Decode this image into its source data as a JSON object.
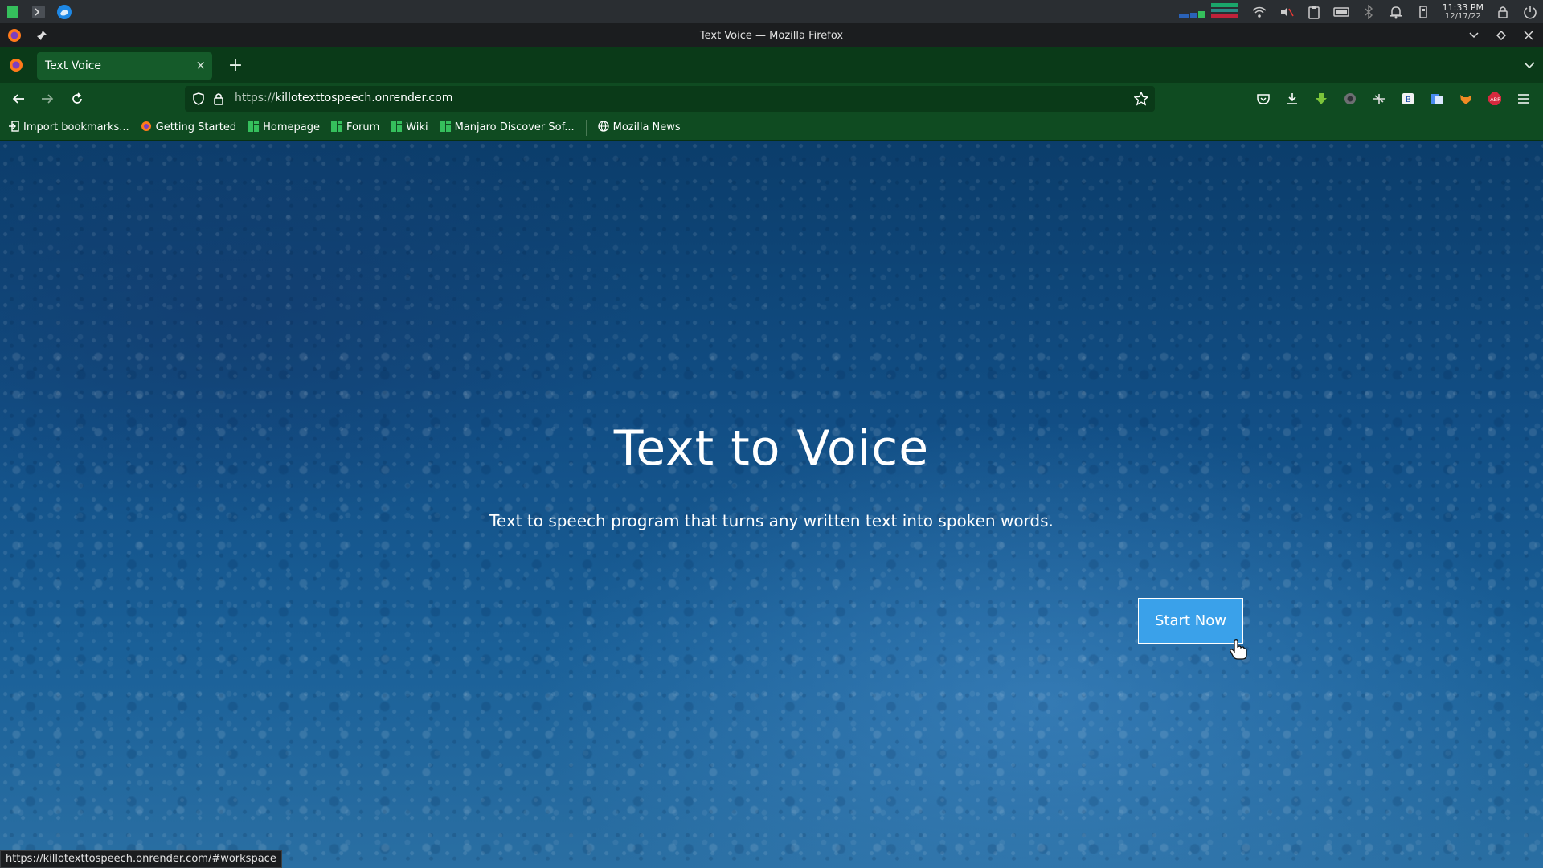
{
  "panel": {
    "time": "11:33 PM",
    "date": "12/17/22"
  },
  "window": {
    "title": "Text Voice — Mozilla Firefox"
  },
  "tab": {
    "label": "Text Voice",
    "close_glyph": "×",
    "new_tab_glyph": "+"
  },
  "address": {
    "protocol": "https://",
    "host": "killotexttospeech.onrender.com"
  },
  "bookmarks": [
    {
      "label": "Import bookmarks...",
      "icon": "import-icon"
    },
    {
      "label": "Getting Started",
      "icon": "firefox-icon"
    },
    {
      "label": "Homepage",
      "icon": "manjaro-icon"
    },
    {
      "label": "Forum",
      "icon": "manjaro-icon"
    },
    {
      "label": "Wiki",
      "icon": "manjaro-icon"
    },
    {
      "label": "Manjaro Discover Sof...",
      "icon": "manjaro-icon"
    },
    {
      "label": "Mozilla News",
      "icon": "globe-icon"
    }
  ],
  "hero": {
    "title": "Text to Voice",
    "subtitle": "Text to speech program that turns any written text into spoken words.",
    "cta_label": "Start Now"
  },
  "status_url": "https://killotexttospeech.onrender.com/#workspace",
  "colors": {
    "panel": "#2a2e32",
    "tabstrip": "#0a3a18",
    "toolbar": "#0f4b21",
    "cta": "#3aa1ea"
  }
}
